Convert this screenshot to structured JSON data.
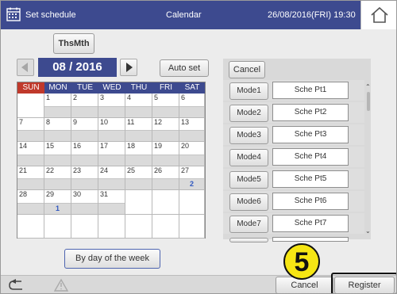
{
  "header": {
    "title": "Set schedule",
    "center_label": "Calendar",
    "datetime": "26/08/2016(FRI) 19:30",
    "bg_color": "#3d4a8f",
    "home_icon": "home-icon"
  },
  "controls": {
    "thsmth_label": "ThsMth",
    "month_label": "08 / 2016",
    "auto_set_label": "Auto set",
    "by_day_label": "By day of the week"
  },
  "calendar": {
    "weekdays": [
      "SUN",
      "MON",
      "TUE",
      "WED",
      "THU",
      "FRI",
      "SAT"
    ],
    "weeks": [
      [
        {
          "d": ""
        },
        {
          "d": "1",
          "p": ""
        },
        {
          "d": "2",
          "p": ""
        },
        {
          "d": "3",
          "p": ""
        },
        {
          "d": "4",
          "p": ""
        },
        {
          "d": "5",
          "p": ""
        },
        {
          "d": "6",
          "p": ""
        }
      ],
      [
        {
          "d": "7",
          "p": ""
        },
        {
          "d": "8",
          "p": ""
        },
        {
          "d": "9",
          "p": ""
        },
        {
          "d": "10",
          "p": ""
        },
        {
          "d": "11",
          "p": ""
        },
        {
          "d": "12",
          "p": ""
        },
        {
          "d": "13",
          "p": ""
        }
      ],
      [
        {
          "d": "14",
          "p": ""
        },
        {
          "d": "15",
          "p": ""
        },
        {
          "d": "16",
          "p": ""
        },
        {
          "d": "17",
          "p": ""
        },
        {
          "d": "18",
          "p": ""
        },
        {
          "d": "19",
          "p": ""
        },
        {
          "d": "20",
          "p": ""
        }
      ],
      [
        {
          "d": "21",
          "p": ""
        },
        {
          "d": "22",
          "p": ""
        },
        {
          "d": "23",
          "p": ""
        },
        {
          "d": "24",
          "p": ""
        },
        {
          "d": "25",
          "p": ""
        },
        {
          "d": "26",
          "p": ""
        },
        {
          "d": "27",
          "p": "2"
        }
      ],
      [
        {
          "d": "28",
          "p": ""
        },
        {
          "d": "29",
          "p": "1"
        },
        {
          "d": "30",
          "p": ""
        },
        {
          "d": "31",
          "p": ""
        },
        {
          "d": ""
        },
        {
          "d": ""
        },
        {
          "d": ""
        }
      ],
      [
        {
          "d": ""
        },
        {
          "d": ""
        },
        {
          "d": ""
        },
        {
          "d": ""
        },
        {
          "d": ""
        },
        {
          "d": ""
        },
        {
          "d": ""
        }
      ]
    ]
  },
  "mode_panel": {
    "cancel_label": "Cancel",
    "modes": [
      {
        "label": "Mode1",
        "pattern": "Sche Pt1"
      },
      {
        "label": "Mode2",
        "pattern": "Sche Pt2"
      },
      {
        "label": "Mode3",
        "pattern": "Sche Pt3"
      },
      {
        "label": "Mode4",
        "pattern": "Sche Pt4"
      },
      {
        "label": "Mode5",
        "pattern": "Sche Pt5"
      },
      {
        "label": "Mode6",
        "pattern": "Sche Pt6"
      },
      {
        "label": "Mode7",
        "pattern": "Sche Pt7"
      }
    ]
  },
  "footer": {
    "cancel_label": "Cancel",
    "register_label": "Register",
    "back_icon": "back-arrow-icon",
    "warning_icon": "warning-icon"
  },
  "step_badge": "5",
  "colors": {
    "accent": "#3d4a8f",
    "sunday": "#c0392b",
    "badge": "#f6e614",
    "pattern_text": "#2f57c0"
  }
}
